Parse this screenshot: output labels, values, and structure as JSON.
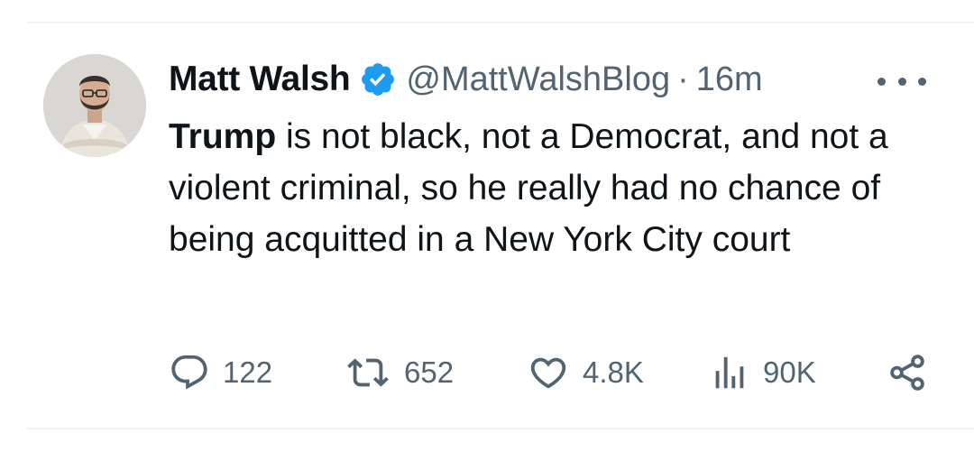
{
  "author": {
    "display_name": "Matt Walsh",
    "handle": "@MattWalshBlog",
    "separator": "·",
    "time_ago": "16m",
    "verified": true
  },
  "tweet": {
    "bold_lead": "Trump",
    "text": " is not black, not a Democrat, and not a violent criminal, so he really had no chance of being acquitted in a New York City court"
  },
  "metrics": {
    "replies": "122",
    "reposts": "652",
    "likes": "4.8K",
    "views": "90K"
  },
  "icons": {
    "verified": "verified-badge-icon",
    "more": "more-icon",
    "reply": "reply-icon",
    "repost": "repost-icon",
    "like": "like-icon",
    "views": "views-icon",
    "share": "share-icon"
  },
  "colors": {
    "text_primary": "#0f1419",
    "text_secondary": "#536471",
    "verified_blue": "#1d9bf0",
    "divider": "#eff3f4"
  }
}
